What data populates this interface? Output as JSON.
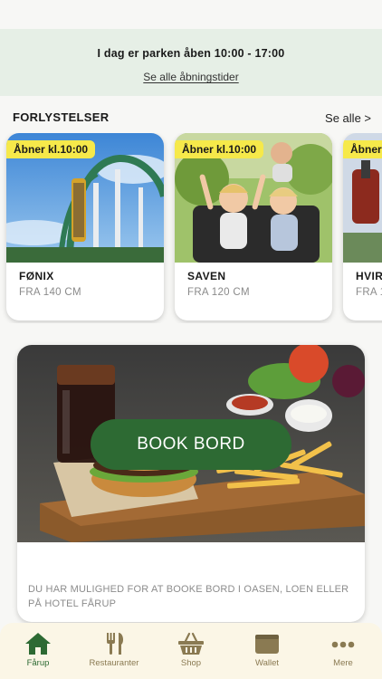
{
  "banner": {
    "title": "I dag er parken åben 10:00 - 17:00",
    "link": "Se alle åbningstider"
  },
  "rides_section": {
    "title": "FORLYSTELSER",
    "see_all": "Se alle >"
  },
  "rides": [
    {
      "badge": "Åbner kl.10:00",
      "name": "FØNIX",
      "height": "FRA 140 CM"
    },
    {
      "badge": "Åbner kl.10:00",
      "name": "SAVEN",
      "height": "FRA 120 CM"
    },
    {
      "badge": "Åbner",
      "name": "HVIR",
      "height": "FRA 1"
    }
  ],
  "promo": {
    "button": "BOOK BORD",
    "text": "DU HAR MULIGHED FOR AT BOOKE BORD I OASEN, LOEN ELLER PÅ HOTEL FÅRUP"
  },
  "tabbar": {
    "items": [
      {
        "label": "Fårup",
        "icon": "home-icon",
        "active": true
      },
      {
        "label": "Restauranter",
        "icon": "fork-knife-icon",
        "active": false
      },
      {
        "label": "Shop",
        "icon": "basket-icon",
        "active": false
      },
      {
        "label": "Wallet",
        "icon": "wallet-icon",
        "active": false
      },
      {
        "label": "Mere",
        "icon": "more-icon",
        "active": false
      }
    ]
  },
  "colors": {
    "accent_green": "#2d6a33",
    "badge_yellow": "#f6e94a",
    "banner_bg": "#e6efe6",
    "tabbar_bg": "#fbf6e6",
    "tab_icon": "#8a7a52"
  }
}
